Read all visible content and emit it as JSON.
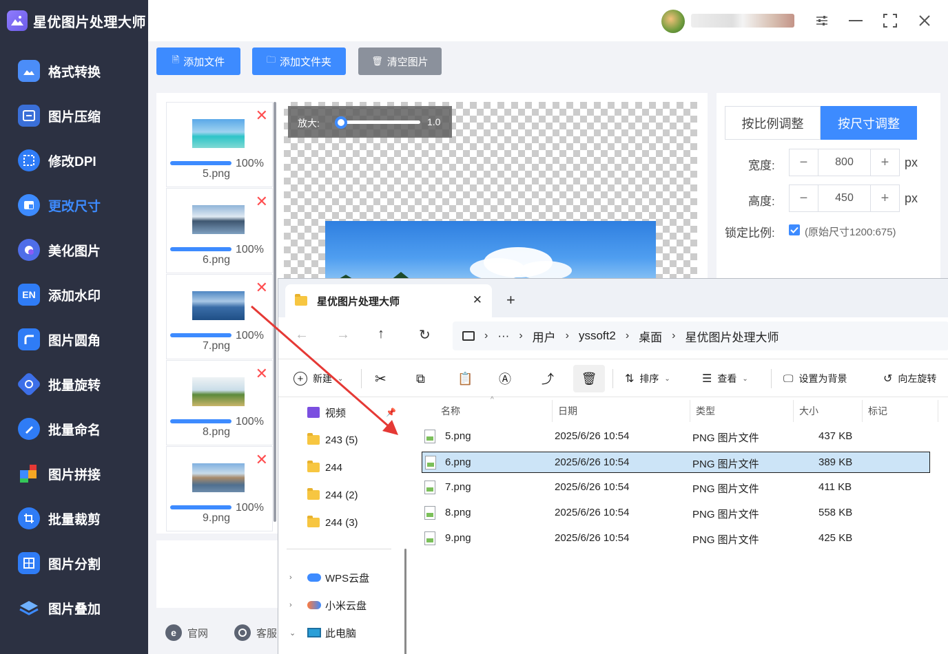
{
  "app": {
    "title": "星优图片处理大师"
  },
  "sidebar": {
    "items": [
      {
        "label": "格式转换",
        "icon": "image-convert-icon"
      },
      {
        "label": "图片压缩",
        "icon": "compress-icon"
      },
      {
        "label": "修改DPI",
        "icon": "dpi-icon"
      },
      {
        "label": "更改尺寸",
        "icon": "resize-icon",
        "active": true
      },
      {
        "label": "美化图片",
        "icon": "beautify-icon"
      },
      {
        "label": "添加水印",
        "icon": "watermark-icon"
      },
      {
        "label": "图片圆角",
        "icon": "round-corner-icon"
      },
      {
        "label": "批量旋转",
        "icon": "rotate-icon"
      },
      {
        "label": "批量命名",
        "icon": "rename-icon"
      },
      {
        "label": "图片拼接",
        "icon": "puzzle-icon"
      },
      {
        "label": "批量裁剪",
        "icon": "crop-icon"
      },
      {
        "label": "图片分割",
        "icon": "split-icon"
      },
      {
        "label": "图片叠加",
        "icon": "layers-icon"
      }
    ]
  },
  "actions": {
    "add_file": "添加文件",
    "add_folder": "添加文件夹",
    "clear": "清空图片"
  },
  "files": [
    {
      "name": "5.png",
      "progress": "100%"
    },
    {
      "name": "6.png",
      "progress": "100%"
    },
    {
      "name": "7.png",
      "progress": "100%"
    },
    {
      "name": "8.png",
      "progress": "100%"
    },
    {
      "name": "9.png",
      "progress": "100%"
    }
  ],
  "preview": {
    "zoom_label": "放大:",
    "zoom_value": "1.0"
  },
  "footer": {
    "website": "官网",
    "service": "客服"
  },
  "settings": {
    "mode_ratio": "按比例调整",
    "mode_size": "按尺寸调整",
    "width_label": "宽度:",
    "width_value": "800",
    "height_label": "高度:",
    "height_value": "450",
    "unit": "px",
    "lock_label": "锁定比例:",
    "lock_note": "(原始尺寸1200:675)",
    "lock_checked": true
  },
  "explorer": {
    "tab_title": "星优图片处理大师",
    "breadcrumb": [
      "用户",
      "yssoft2",
      "桌面",
      "星优图片处理大师"
    ],
    "toolbar": {
      "new": "新建",
      "sort": "排序",
      "view": "查看",
      "set_bg": "设置为背景",
      "rotate_left": "向左旋转"
    },
    "nav": {
      "video": "视频",
      "folders": [
        "243 (5)",
        "244",
        "244 (2)",
        "244 (3)"
      ],
      "wps": "WPS云盘",
      "mi": "小米云盘",
      "pc": "此电脑"
    },
    "columns": {
      "name": "名称",
      "date": "日期",
      "type": "类型",
      "size": "大小",
      "tag": "标记"
    },
    "rows": [
      {
        "name": "5.png",
        "date": "2025/6/26 10:54",
        "type": "PNG 图片文件",
        "size": "437 KB"
      },
      {
        "name": "6.png",
        "date": "2025/6/26 10:54",
        "type": "PNG 图片文件",
        "size": "389 KB",
        "selected": true
      },
      {
        "name": "7.png",
        "date": "2025/6/26 10:54",
        "type": "PNG 图片文件",
        "size": "411 KB"
      },
      {
        "name": "8.png",
        "date": "2025/6/26 10:54",
        "type": "PNG 图片文件",
        "size": "558 KB"
      },
      {
        "name": "9.png",
        "date": "2025/6/26 10:54",
        "type": "PNG 图片文件",
        "size": "425 KB"
      }
    ]
  },
  "colors": {
    "accent": "#3d8bff",
    "sidebar": "#2c3142",
    "delete": "#ff4d4f",
    "arrow": "#e53935"
  }
}
